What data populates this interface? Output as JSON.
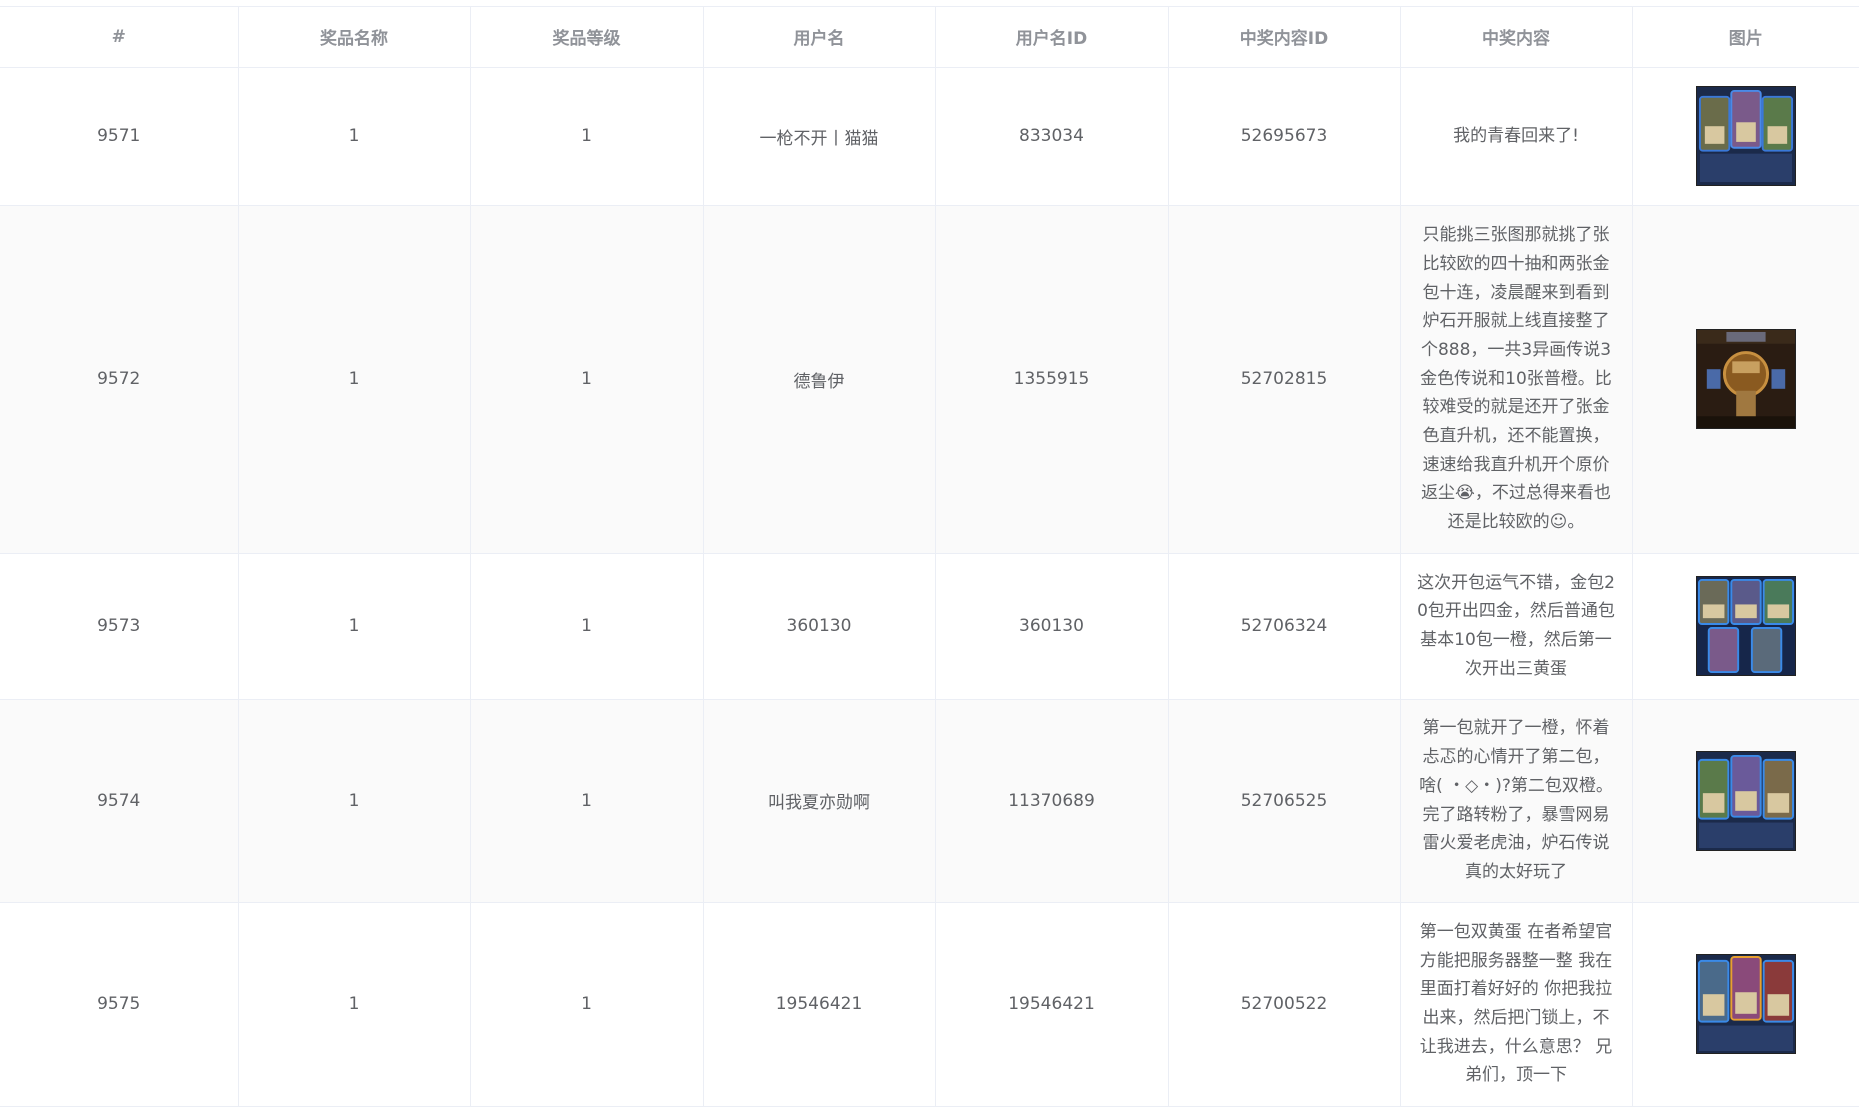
{
  "table": {
    "headers": [
      "#",
      "奖品名称",
      "奖品等级",
      "用户名",
      "用户名ID",
      "中奖内容ID",
      "中奖内容",
      "图片"
    ],
    "rows": [
      {
        "id": "9571",
        "prize_name": "1",
        "prize_level": "1",
        "username": "一枪不开丨猫猫",
        "user_id": "833034",
        "content_id": "52695673",
        "content": "我的青春回来了!",
        "image": "hearthstone-cards-thumbnail"
      },
      {
        "id": "9572",
        "prize_name": "1",
        "prize_level": "1",
        "username": "德鲁伊",
        "user_id": "1355915",
        "content_id": "52702815",
        "content": "只能挑三张图那就挑了张比较欧的四十抽和两张金包十连，凌晨醒来到看到炉石开服就上线直接整了个888，一共3异画传说3金色传说和10张普橙。比较难受的就是还开了张金色直升机，还不能置换，速速给我直升机开个原价返尘😭，不过总得来看也还是比较欧的☺。",
        "image": "hearthstone-board-thumbnail"
      },
      {
        "id": "9573",
        "prize_name": "1",
        "prize_level": "1",
        "username": "360130",
        "user_id": "360130",
        "content_id": "52706324",
        "content": "这次开包运气不错，金包20包开出四金，然后普通包基本10包一橙，然后第一次开出三黄蛋",
        "image": "hearthstone-cards-thumbnail"
      },
      {
        "id": "9574",
        "prize_name": "1",
        "prize_level": "1",
        "username": "叫我夏亦勋啊",
        "user_id": "11370689",
        "content_id": "52706525",
        "content": "第一包就开了一橙，怀着忐忑的心情开了第二包，啥( ・◇・)?第二包双橙。完了路转粉了，暴雪网易雷火爱老虎油，炉石传说真的太好玩了",
        "image": "hearthstone-cards-thumbnail"
      },
      {
        "id": "9575",
        "prize_name": "1",
        "prize_level": "1",
        "username": "19546421",
        "user_id": "19546421",
        "content_id": "52700522",
        "content": "第一包双黄蛋 在者希望官方能把服务器整一整 我在里面打着好好的 你把我拉出来，然后把门锁上，不让我进去，什么意思？ 兄弟们，顶一下",
        "image": "hearthstone-cards-thumbnail"
      }
    ]
  }
}
